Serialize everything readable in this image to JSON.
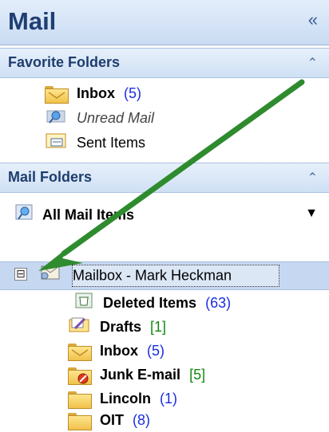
{
  "pane": {
    "title": "Mail",
    "collapse_label": "«"
  },
  "favorite_folders": {
    "title": "Favorite Folders",
    "chevron": "⌃",
    "items": [
      {
        "label": "Inbox",
        "count": "(5)",
        "icon": "inbox-folder-icon"
      },
      {
        "label": "Unread Mail",
        "icon": "search-folder-icon"
      },
      {
        "label": "Sent Items",
        "icon": "sent-items-icon"
      }
    ]
  },
  "mail_folders": {
    "title": "Mail Folders",
    "chevron": "⌃",
    "all_items": "All Mail Items",
    "dropdown_chevron": "▼",
    "mailbox": {
      "label": "Mailbox - Mark Heckman",
      "expand": "⊟"
    },
    "children": [
      {
        "label": "Deleted Items",
        "count": "(63)",
        "count_color": "blue",
        "icon": "deleted-items-icon"
      },
      {
        "label": "Drafts",
        "count": "[1]",
        "count_color": "green",
        "icon": "drafts-icon"
      },
      {
        "label": "Inbox",
        "count": "(5)",
        "count_color": "blue",
        "icon": "inbox-folder-icon"
      },
      {
        "label": "Junk E-mail",
        "count": "[5]",
        "count_color": "green",
        "icon": "junk-folder-icon"
      },
      {
        "label": "Lincoln",
        "count": "(1)",
        "count_color": "blue",
        "icon": "folder-icon"
      },
      {
        "label": "OIT",
        "count": "(8)",
        "count_color": "blue",
        "icon": "folder-icon"
      }
    ]
  },
  "colors": {
    "accent_arrow": "#2e8b2e",
    "header_text": "#1f3f73",
    "count_blue": "#1a2ee0",
    "count_green": "#138a13"
  }
}
